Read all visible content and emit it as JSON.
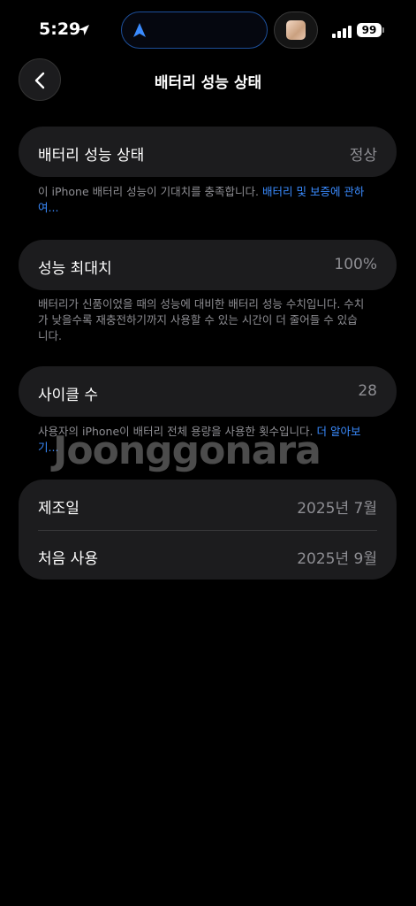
{
  "status": {
    "time": "5:29",
    "battery": "99"
  },
  "nav": {
    "title": "배터리 성능 상태"
  },
  "health": {
    "label": "배터리 성능 상태",
    "value": "정상",
    "footer": "이 iPhone 배터리 성능이 기대치를 충족합니다. ",
    "footer_link": "배터리 및 보증에 관하여..."
  },
  "capacity": {
    "label": "성능 최대치",
    "value": "100%",
    "footer": "배터리가 신품이었을 때의 성능에 대비한 배터리 성능 수치입니다. 수치가 낮을수록 재충전하기까지 사용할 수 있는 시간이 더 줄어들 수 있습니다."
  },
  "cycles": {
    "label": "사이클 수",
    "value": "28",
    "footer": "사용자의 iPhone이 배터리 전체 용량을 사용한 횟수입니다. ",
    "footer_link": "더 알아보기..."
  },
  "dates": {
    "manufactured_label": "제조일",
    "manufactured_value": "2025년 7월",
    "first_use_label": "처음 사용",
    "first_use_value": "2025년 9월"
  },
  "watermark": "Joonggonara"
}
